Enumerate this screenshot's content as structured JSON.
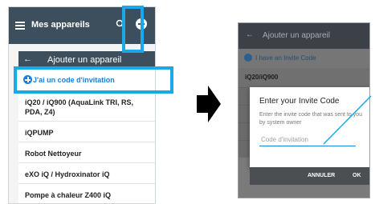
{
  "left_screen": {
    "app_title": "Mes appareils",
    "subbar_title": "Ajouter un appareil",
    "invite_label": "J'ai un code d'invitation",
    "items": [
      "iQ20 / iQ900 (AquaLink TRI, RS,",
      "PDA, Z4)",
      "iQPUMP",
      "Robot Nettoyeur",
      "eXO iQ / Hydroxinator iQ",
      "Pompe à chaleur Z400 iQ"
    ]
  },
  "right_screen": {
    "title": "Ajouter un appareil",
    "invite_label": "I have an Invite Code",
    "item_1": "iQ20/iQ900",
    "dialog": {
      "title": "Enter your Invite Code",
      "message": "Enter the invite code that was sent to you by system owner",
      "input_placeholder": "Code d'invitation",
      "cancel_label": "ANNULER",
      "ok_label": "OK"
    }
  },
  "colors": {
    "highlight": "#1aa8e6",
    "topbar": "#3d4f5c",
    "link_blue": "#1b7fd6"
  }
}
